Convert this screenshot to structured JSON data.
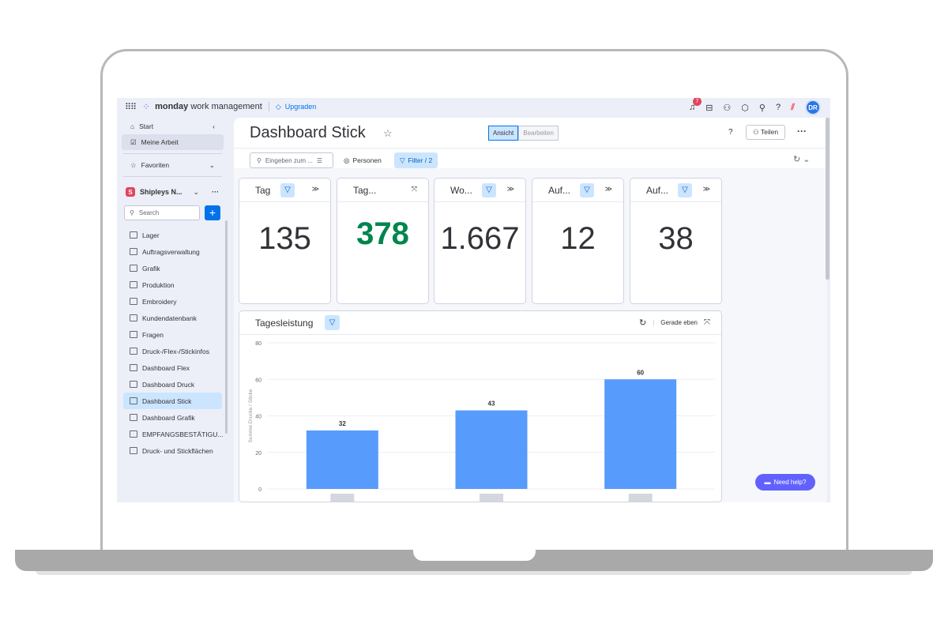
{
  "app": {
    "brand_bold": "monday",
    "brand_rest": "work management",
    "upgrade_label": "Upgraden",
    "notification_count": "7",
    "avatar_initials": "DR"
  },
  "sidebar": {
    "start": "Start",
    "my_work": "Meine Arbeit",
    "favorites": "Favoriten",
    "workspace_badge": "S",
    "workspace_name": "Shipleys N...",
    "search_placeholder": "Search",
    "boards": [
      {
        "label": "Lager"
      },
      {
        "label": "Auftragsverwaltung"
      },
      {
        "label": "Grafik"
      },
      {
        "label": "Produktion"
      },
      {
        "label": "Embroidery"
      },
      {
        "label": "Kundendatenbank"
      },
      {
        "label": "Fragen"
      },
      {
        "label": "Druck-/Flex-/Stickinfos"
      },
      {
        "label": "Dashboard Flex"
      },
      {
        "label": "Dashboard Druck"
      },
      {
        "label": "Dashboard Stick"
      },
      {
        "label": "Dashboard Grafik"
      },
      {
        "label": "EMPFANGSBESTÄTIGU..."
      },
      {
        "label": "Druck- und Stickflächen"
      }
    ]
  },
  "header": {
    "title": "Dashboard Stick",
    "view_label": "Ansicht",
    "edit_label": "Bearbeiten",
    "help": "?",
    "share_label": "Teilen",
    "search_placeholder": "Eingeben zum ...",
    "persons_label": "Personen",
    "filter_label": "Filter / 2"
  },
  "cards": [
    {
      "title": "Tag",
      "value": "135"
    },
    {
      "title": "Tag...",
      "value": "378"
    },
    {
      "title": "Wo...",
      "value": "1.667"
    },
    {
      "title": "Auf...",
      "value": "12"
    },
    {
      "title": "Auf...",
      "value": "38"
    }
  ],
  "chart_widget": {
    "title": "Tagesleistung",
    "period_label": "Gerade eben"
  },
  "chart_data": {
    "type": "bar",
    "categories": [
      "",
      "",
      ""
    ],
    "values": [
      32,
      43,
      60
    ],
    "ylabel": "Summe Drucke / Sticke",
    "ylim": [
      0,
      80
    ],
    "yticks": [
      0,
      20,
      40,
      60,
      80
    ],
    "bar_color": "#579bfc",
    "grid": true
  },
  "need_help": "Need help?"
}
